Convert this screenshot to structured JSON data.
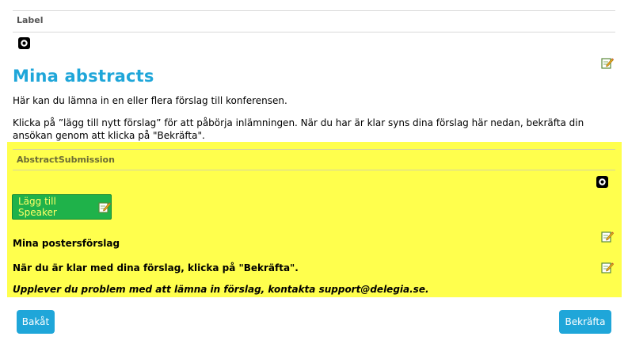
{
  "label_widget": {
    "heading": "Label"
  },
  "content": {
    "title": "Mina abstracts",
    "intro": "Här kan du lämna in en eller flera förslag till konferensen.",
    "instructions": "Klicka på ”lägg till nytt förslag” för att påbörja inlämningen. När du har är klar syns dina förslag här nedan, bekräfta din ansökan genom att klicka på \"Bekräfta\"."
  },
  "abstract_submission": {
    "heading": "AbstractSubmission",
    "add_button_label": "Lägg till Speaker",
    "poster_heading": "Mina postersförslag",
    "confirm_note": "När du är klar med dina förslag, klicka på \"Bekräfta\".",
    "support_note": "Upplever du problem med att lämna in förslag, kontakta support@delegia.se."
  },
  "footer": {
    "back_label": "Bakåt",
    "confirm_label": "Bekräfta"
  },
  "colors": {
    "accent": "#1fa6d9",
    "highlight": "#ffff4d",
    "add_button": "#1fb24a"
  },
  "icons": [
    "gear-icon",
    "edit-icon"
  ]
}
